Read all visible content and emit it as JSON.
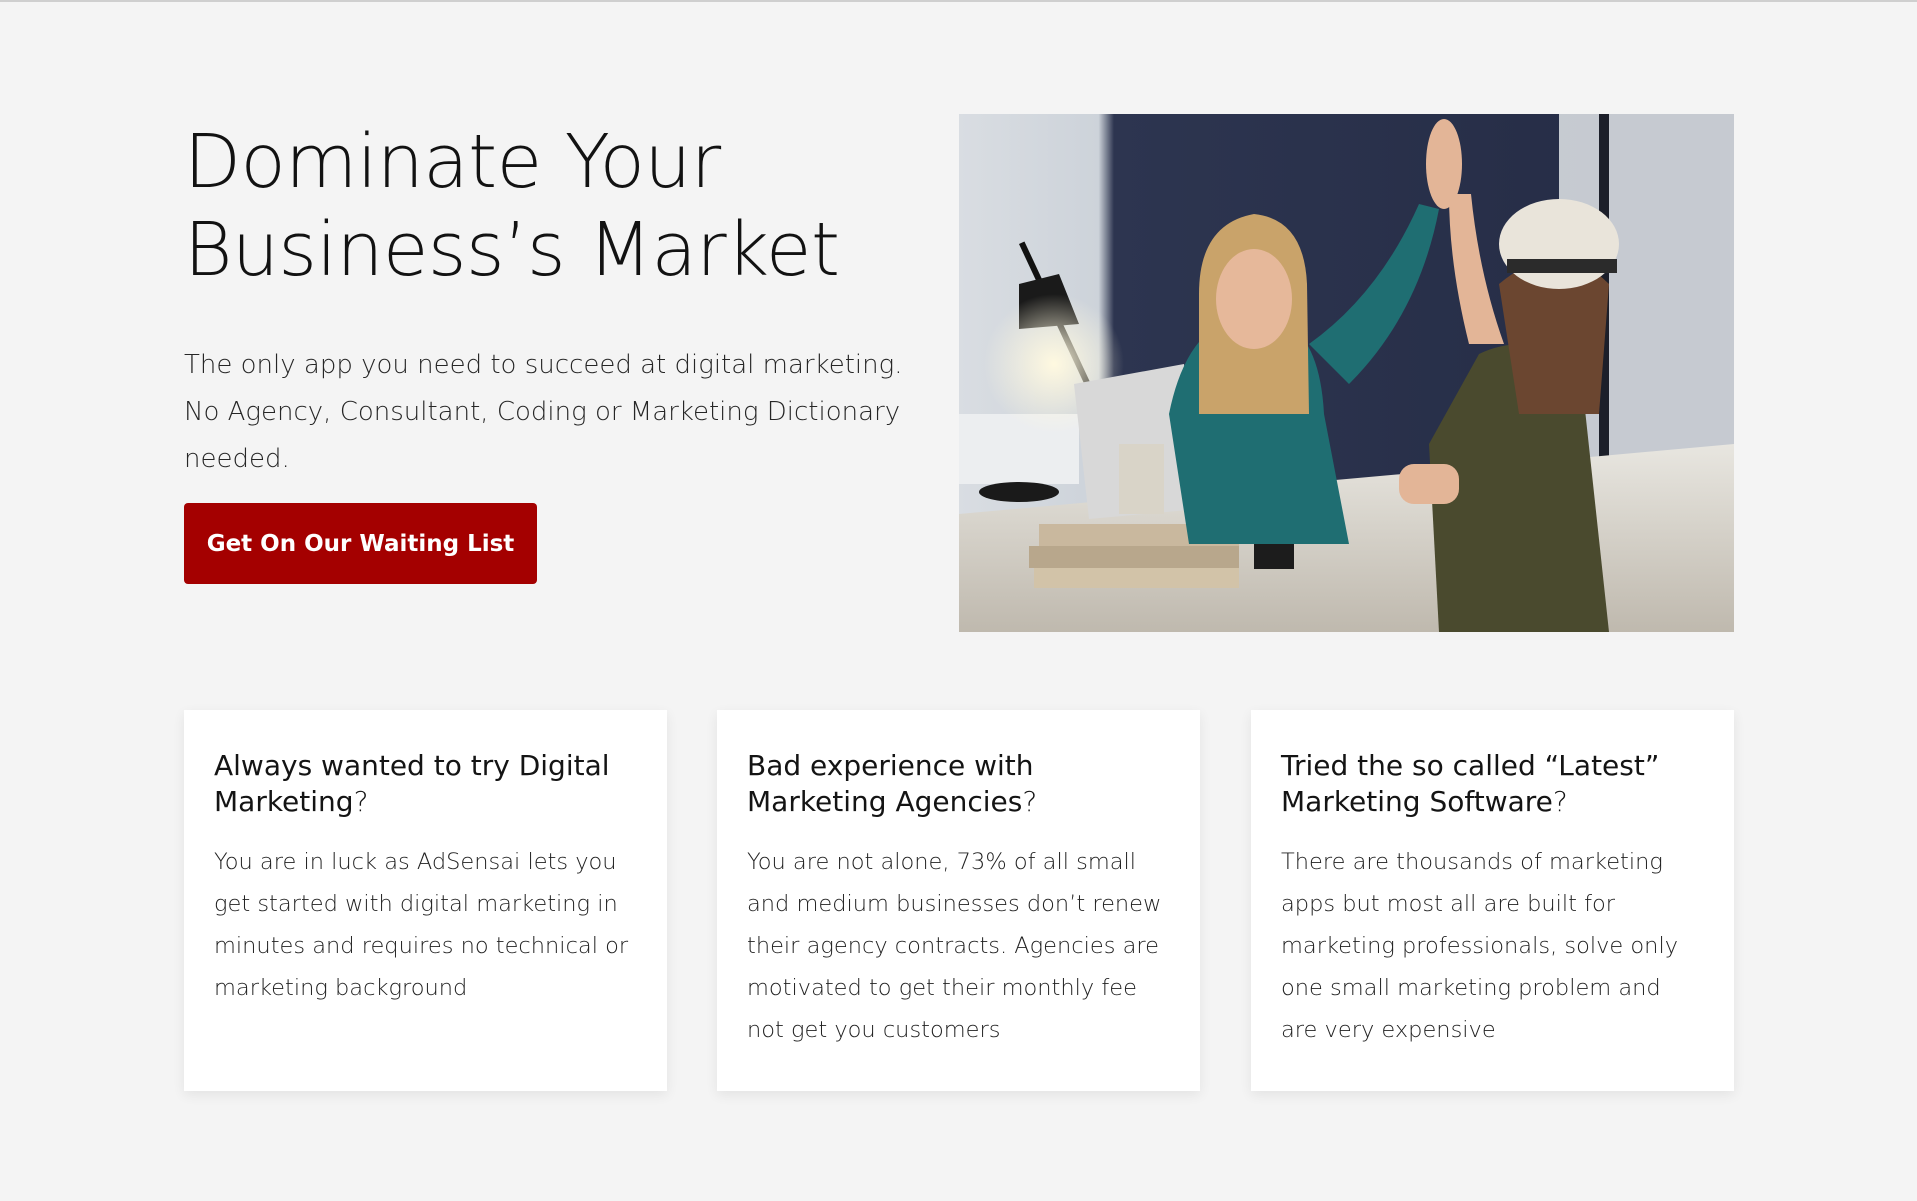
{
  "hero": {
    "title_line1": "Dominate Your",
    "title_line2": "Business’s Market",
    "subtitle": "The only app you need to succeed at digital marketing. No Agency, Consultant, Coding or Marketing Dictionary needed.",
    "cta_label": "Get On Our Waiting List"
  },
  "cards": [
    {
      "title": "Always wanted to try Digital Marketing",
      "qmark": "?",
      "body": "You are in luck as AdSensai lets you get started with digital marketing in minutes and requires no technical or marketing background"
    },
    {
      "title": "Bad experience with Marketing Agencies",
      "qmark": "?",
      "body": "You are not alone, 73% of all small and medium businesses don’t renew their agency contracts. Agencies are motivated to get their monthly fee not get you customers"
    },
    {
      "title": "Tried the so called “Latest” Marketing Software",
      "qmark": "?",
      "body": "There are thousands of marketing apps but most all are built for marketing professionals, solve only one small marketing problem and are very expensive"
    }
  ],
  "colors": {
    "background": "#f4f4f4",
    "accent": "#a40000",
    "card": "#ffffff"
  }
}
